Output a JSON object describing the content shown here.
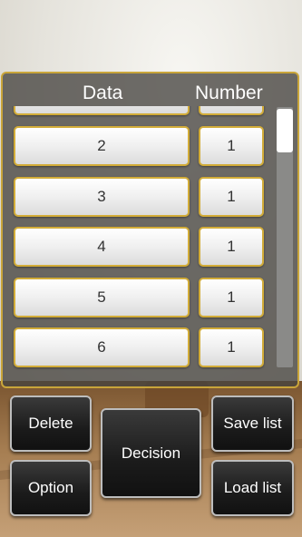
{
  "table": {
    "header_data": "Data",
    "header_number": "Number",
    "rows": [
      {
        "data": "",
        "number": ""
      },
      {
        "data": "2",
        "number": "1"
      },
      {
        "data": "3",
        "number": "1"
      },
      {
        "data": "4",
        "number": "1"
      },
      {
        "data": "5",
        "number": "1"
      },
      {
        "data": "6",
        "number": "1"
      }
    ]
  },
  "buttons": {
    "delete": "Delete",
    "option": "Option",
    "decision": "Decision",
    "save_list": "Save list",
    "load_list": "Load list"
  }
}
